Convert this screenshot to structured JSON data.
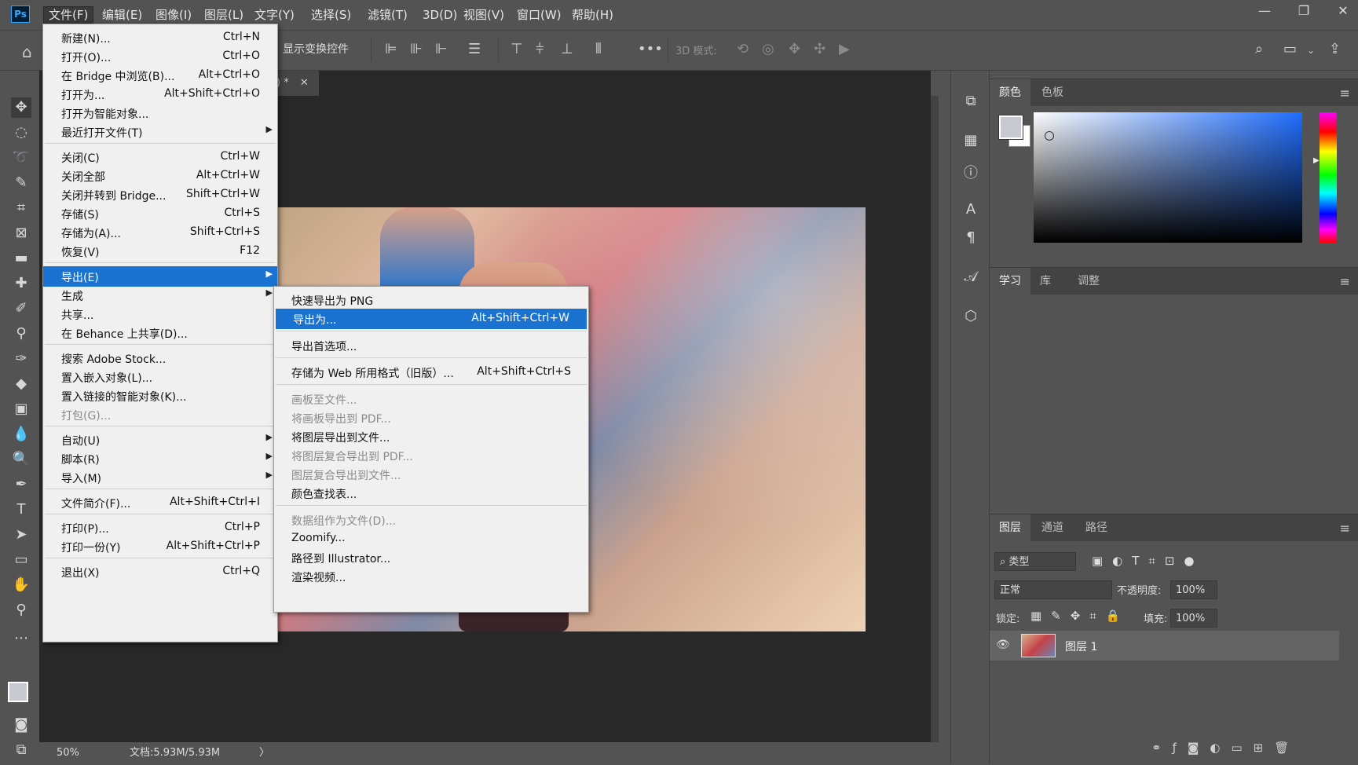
{
  "app": {
    "logo": "Ps"
  },
  "menubar": [
    "文件(F)",
    "编辑(E)",
    "图像(I)",
    "图层(L)",
    "文字(Y)",
    "选择(S)",
    "滤镜(T)",
    "3D(D)",
    "视图(V)",
    "窗口(W)",
    "帮助(H)"
  ],
  "window_controls": {
    "minimize": "—",
    "restore": "❐",
    "close": "✕"
  },
  "options": {
    "show_transform": "显示变换控件",
    "more": "•••",
    "mode_3d": "3D 模式:"
  },
  "tab": {
    "label": ") *",
    "close": "✕"
  },
  "status": {
    "zoom": "50%",
    "doc": "文档:5.93M/5.93M",
    "arrow": "〉"
  },
  "file_menu": {
    "items": [
      {
        "label": "新建(N)...",
        "shortcut": "Ctrl+N"
      },
      {
        "label": "打开(O)...",
        "shortcut": "Ctrl+O"
      },
      {
        "label": "在 Bridge 中浏览(B)...",
        "shortcut": "Alt+Ctrl+O"
      },
      {
        "label": "打开为...",
        "shortcut": "Alt+Shift+Ctrl+O"
      },
      {
        "label": "打开为智能对象...",
        "shortcut": ""
      },
      {
        "label": "最近打开文件(T)",
        "shortcut": "",
        "arrow": true
      },
      {
        "sep": true
      },
      {
        "label": "关闭(C)",
        "shortcut": "Ctrl+W"
      },
      {
        "label": "关闭全部",
        "shortcut": "Alt+Ctrl+W"
      },
      {
        "label": "关闭并转到 Bridge...",
        "shortcut": "Shift+Ctrl+W"
      },
      {
        "label": "存储(S)",
        "shortcut": "Ctrl+S"
      },
      {
        "label": "存储为(A)...",
        "shortcut": "Shift+Ctrl+S"
      },
      {
        "label": "恢复(V)",
        "shortcut": "F12"
      },
      {
        "sep": true
      },
      {
        "label": "导出(E)",
        "shortcut": "",
        "arrow": true,
        "highlight": true
      },
      {
        "label": "生成",
        "shortcut": "",
        "arrow": true
      },
      {
        "label": "共享...",
        "shortcut": ""
      },
      {
        "label": "在 Behance 上共享(D)...",
        "shortcut": ""
      },
      {
        "sep": true
      },
      {
        "label": "搜索 Adobe Stock...",
        "shortcut": ""
      },
      {
        "label": "置入嵌入对象(L)...",
        "shortcut": ""
      },
      {
        "label": "置入链接的智能对象(K)...",
        "shortcut": ""
      },
      {
        "label": "打包(G)...",
        "shortcut": "",
        "disabled": true
      },
      {
        "sep": true
      },
      {
        "label": "自动(U)",
        "shortcut": "",
        "arrow": true
      },
      {
        "label": "脚本(R)",
        "shortcut": "",
        "arrow": true
      },
      {
        "label": "导入(M)",
        "shortcut": "",
        "arrow": true
      },
      {
        "sep": true
      },
      {
        "label": "文件简介(F)...",
        "shortcut": "Alt+Shift+Ctrl+I"
      },
      {
        "sep": true
      },
      {
        "label": "打印(P)...",
        "shortcut": "Ctrl+P"
      },
      {
        "label": "打印一份(Y)",
        "shortcut": "Alt+Shift+Ctrl+P"
      },
      {
        "sep": true
      },
      {
        "label": "退出(X)",
        "shortcut": "Ctrl+Q"
      }
    ]
  },
  "export_menu": {
    "items": [
      {
        "label": "快速导出为 PNG",
        "shortcut": ""
      },
      {
        "label": "导出为...",
        "shortcut": "Alt+Shift+Ctrl+W",
        "highlight": true
      },
      {
        "sep": true
      },
      {
        "label": "导出首选项...",
        "shortcut": ""
      },
      {
        "sep": true
      },
      {
        "label": "存储为 Web 所用格式（旧版）...",
        "shortcut": "Alt+Shift+Ctrl+S"
      },
      {
        "sep": true
      },
      {
        "label": "画板至文件...",
        "shortcut": "",
        "disabled": true
      },
      {
        "label": "将画板导出到 PDF...",
        "shortcut": "",
        "disabled": true
      },
      {
        "label": "将图层导出到文件...",
        "shortcut": ""
      },
      {
        "label": "将图层复合导出到 PDF...",
        "shortcut": "",
        "disabled": true
      },
      {
        "label": "图层复合导出到文件...",
        "shortcut": "",
        "disabled": true
      },
      {
        "label": "颜色查找表...",
        "shortcut": ""
      },
      {
        "sep": true
      },
      {
        "label": "数据组作为文件(D)...",
        "shortcut": "",
        "disabled": true
      },
      {
        "label": "Zoomify...",
        "shortcut": ""
      },
      {
        "label": "路径到 Illustrator...",
        "shortcut": ""
      },
      {
        "label": "渲染视频...",
        "shortcut": ""
      }
    ]
  },
  "panels": {
    "color_tabs": [
      "颜色",
      "色板"
    ],
    "learn_tabs": [
      "学习",
      "库",
      "调整"
    ],
    "layers_tabs": [
      "图层",
      "通道",
      "路径"
    ],
    "filter_kind": "类型",
    "blend_mode": "正常",
    "opacity_label": "不透明度:",
    "opacity_value": "100%",
    "lock_label": "锁定:",
    "fill_label": "填充:",
    "fill_value": "100%",
    "layer_name": "图层 1",
    "menu_glyph": "≡"
  },
  "colors": {
    "accent": "#1a73d1",
    "ui_bg": "#535353",
    "canvas_bg": "#282828"
  }
}
